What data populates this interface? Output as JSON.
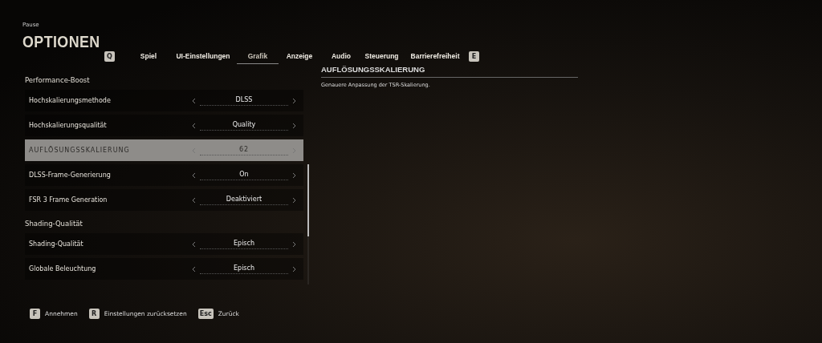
{
  "header": {
    "breadcrumb": "Pause",
    "title": "OPTIONEN"
  },
  "tab_prev_key": "Q",
  "tabs": [
    {
      "label": "Spiel",
      "selected": false
    },
    {
      "label": "UI-Einstellungen",
      "selected": false
    },
    {
      "label": "Grafik",
      "selected": true
    },
    {
      "label": "Anzeige",
      "selected": false
    },
    {
      "label": "Audio",
      "selected": false
    },
    {
      "label": "Steuerung",
      "selected": false
    },
    {
      "label": "Barrierefreiheit",
      "selected": false
    }
  ],
  "tab_next_key": "E",
  "settings": [
    {
      "kind": "heading",
      "label": "Performance-Boost"
    },
    {
      "kind": "setting",
      "label": "Hochskalierungsmethode",
      "value": "DLSS",
      "selected": false
    },
    {
      "kind": "setting",
      "label": "Hochskalierungsqualität",
      "value": "Quality",
      "selected": false
    },
    {
      "kind": "setting",
      "label": "AUFLÖSUNGSSKALIERUNG",
      "value": "62",
      "selected": true
    },
    {
      "kind": "setting",
      "label": "DLSS-Frame-Generierung",
      "value": "On",
      "selected": false
    },
    {
      "kind": "setting",
      "label": "FSR 3 Frame Generation",
      "value": "Deaktiviert",
      "selected": false
    },
    {
      "kind": "heading",
      "label": "Shading-Qualität"
    },
    {
      "kind": "setting",
      "label": "Shading-Qualität",
      "value": "Episch",
      "selected": false
    },
    {
      "kind": "setting",
      "label": "Globale Beleuchtung",
      "value": "Episch",
      "selected": false
    }
  ],
  "details": {
    "title": "AUFLÖSUNGSSKALIERUNG",
    "description": "Genauere Anpassung der TSR-Skalierung."
  },
  "footer": [
    {
      "key": "F",
      "label": "Annehmen"
    },
    {
      "key": "R",
      "label": "Einstellungen zurücksetzen"
    },
    {
      "key": "Esc",
      "label": "Zurück"
    }
  ]
}
